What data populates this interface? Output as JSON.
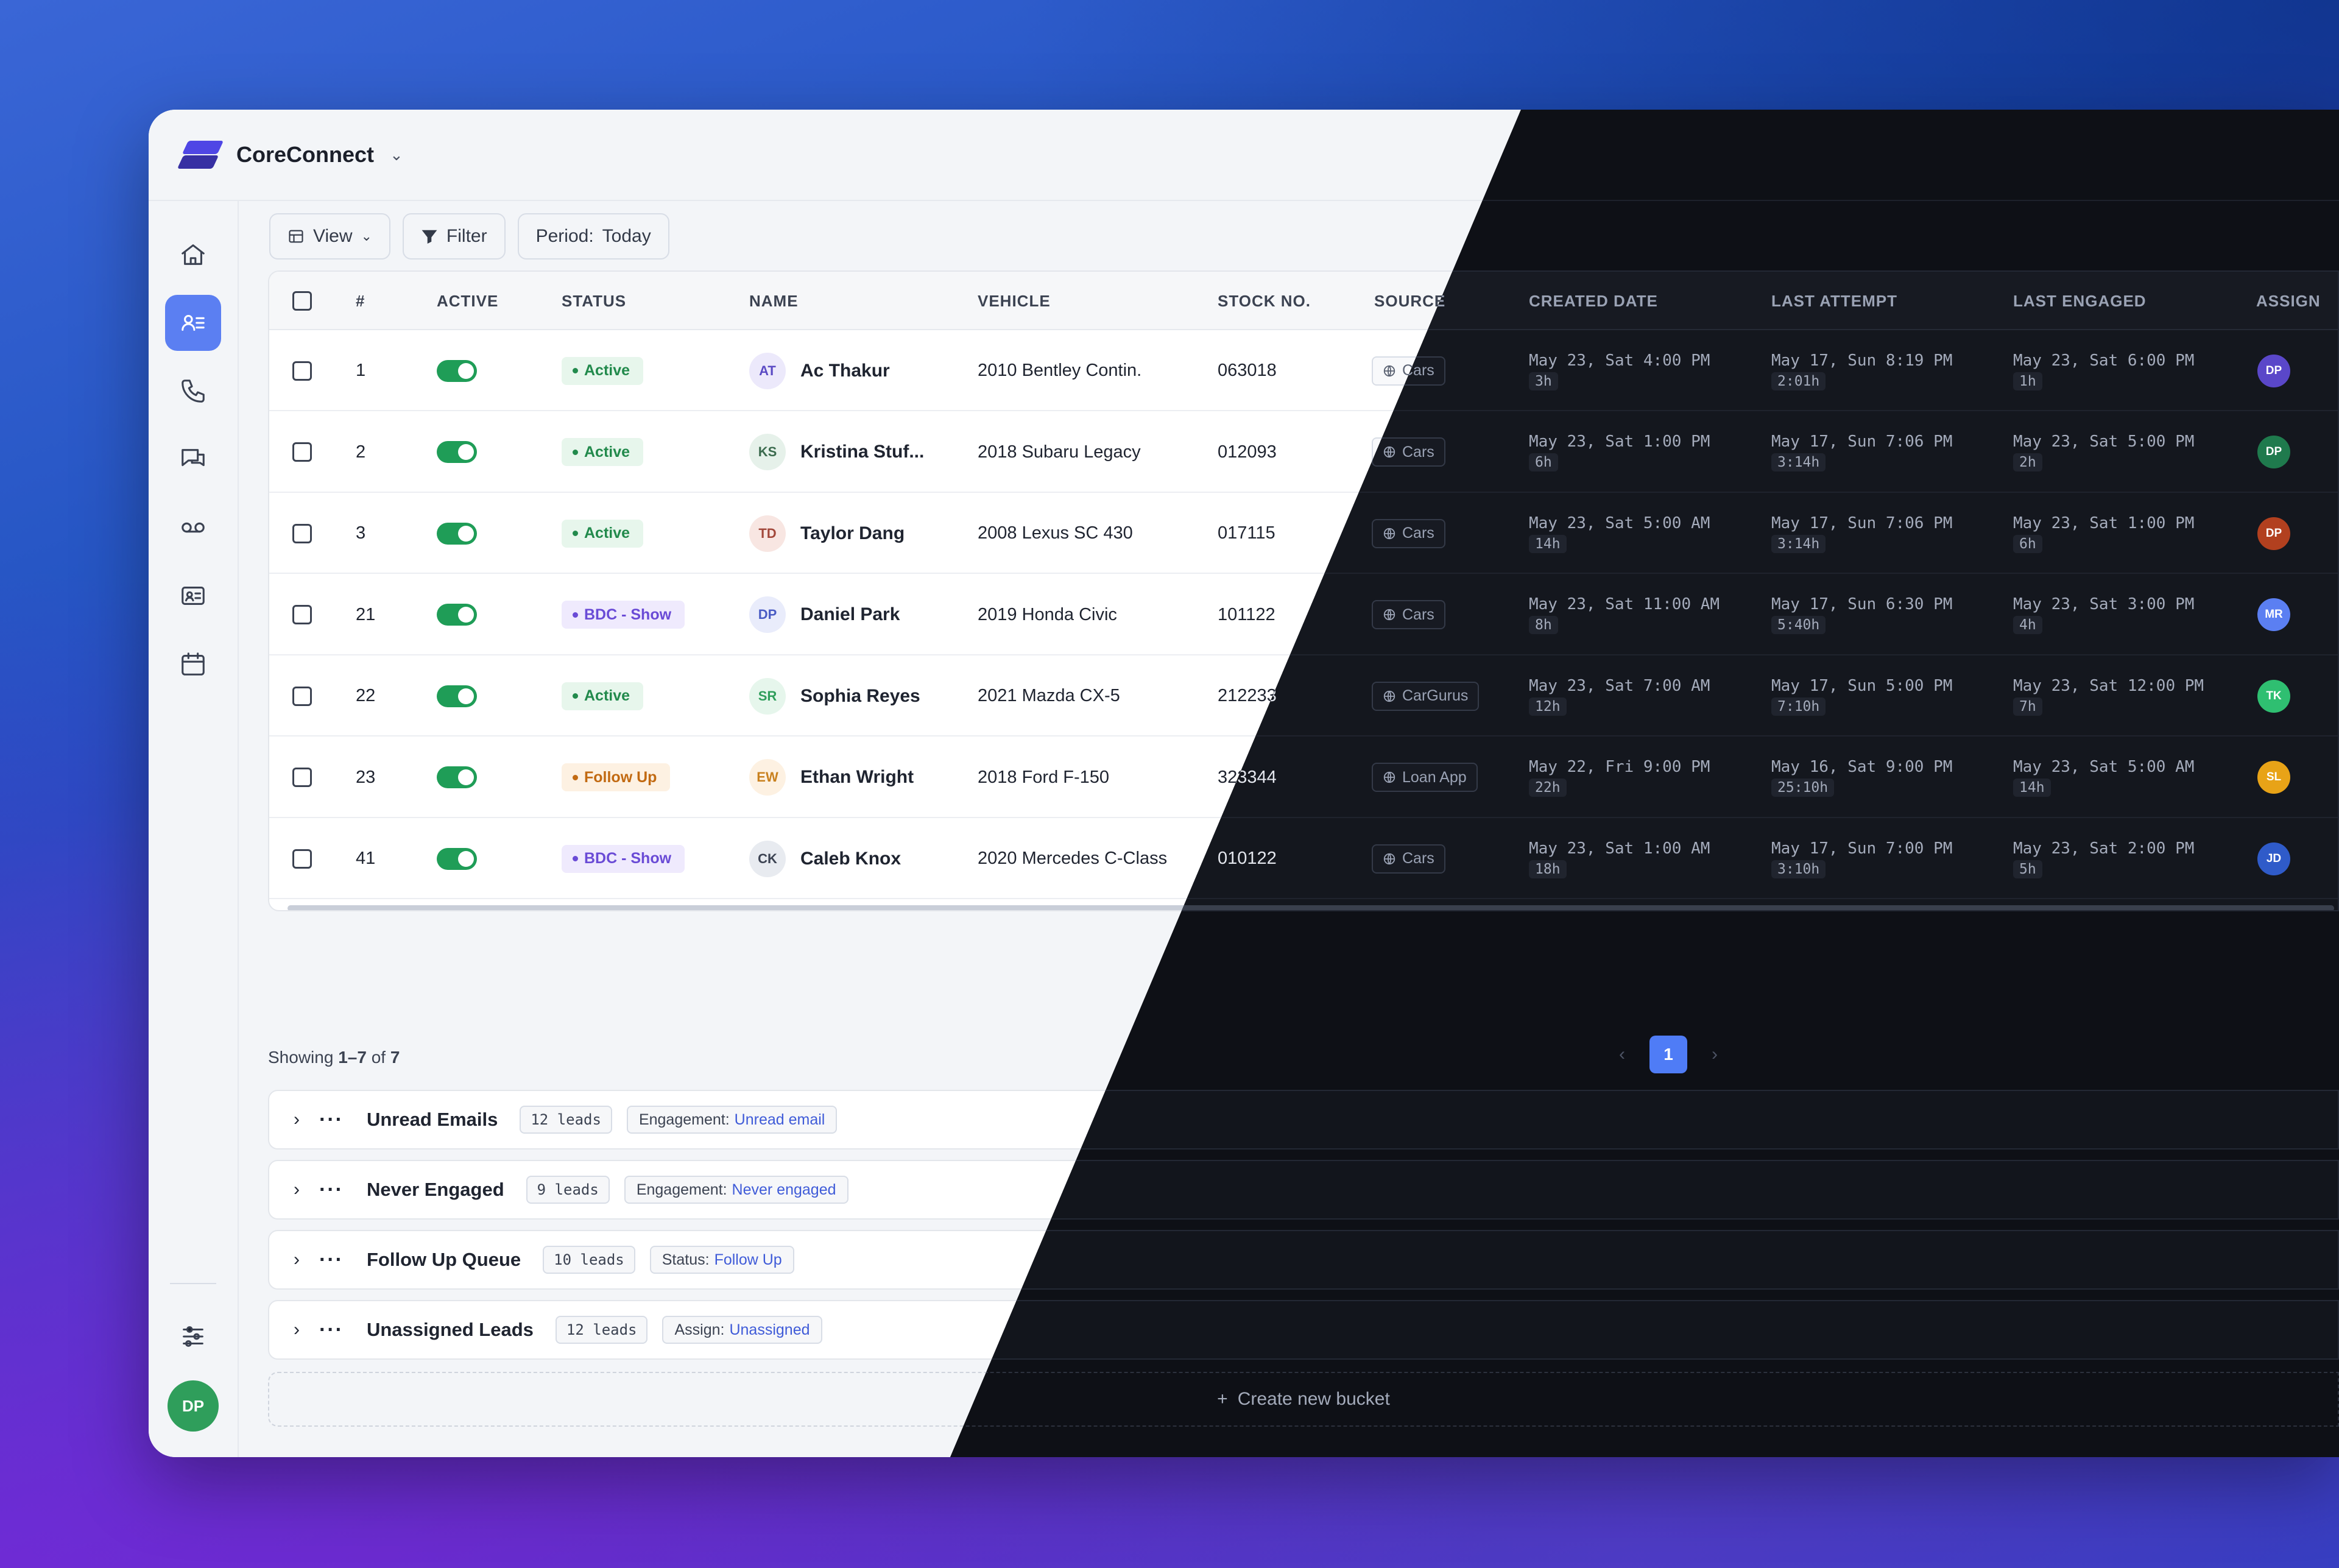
{
  "app": {
    "name": "CoreConnect"
  },
  "user": {
    "initials": "DP",
    "color": "#2f9e5b"
  },
  "sidebar": {
    "items": [
      {
        "key": "home",
        "icon": "home-icon"
      },
      {
        "key": "leads",
        "icon": "contacts-list-icon",
        "active": true
      },
      {
        "key": "calls",
        "icon": "phone-icon"
      },
      {
        "key": "messages",
        "icon": "chat-icon"
      },
      {
        "key": "voicemail",
        "icon": "voicemail-icon"
      },
      {
        "key": "contacts",
        "icon": "id-card-icon"
      },
      {
        "key": "calendar",
        "icon": "calendar-icon"
      }
    ],
    "settings_icon": "sliders-icon"
  },
  "toolbar": {
    "view_label": "View",
    "filter_label": "Filter",
    "period_label": "Period:",
    "period_value": "Today"
  },
  "table": {
    "headers": {
      "num": "#",
      "active": "ACTIVE",
      "status": "STATUS",
      "name": "NAME",
      "vehicle": "VEHICLE",
      "stock": "STOCK NO.",
      "source": "SOURCE",
      "created": "CREATED DATE",
      "last_attempt": "LAST ATTEMPT",
      "last_engaged": "LAST ENGAGED",
      "assign": "ASSIGN"
    },
    "rows": [
      {
        "num": "1",
        "status": "Active",
        "status_kind": "active",
        "initials": "AT",
        "ini_bg": "#ece9fb",
        "ini_fg": "#5b4bc4",
        "name": "Ac Thakur",
        "vehicle": "2010 Bentley Contin.",
        "stock": "063018",
        "source": "Cars",
        "created": "May 23, Sat 4:00 PM",
        "created_ago": "3h",
        "attempt": "May 17, Sun 8:19 PM",
        "attempt_ago": "2:01h",
        "engaged": "May 23, Sat 6:00 PM",
        "engaged_ago": "1h",
        "assign": "DP",
        "assign_color": "#5a47c9"
      },
      {
        "num": "2",
        "status": "Active",
        "status_kind": "active",
        "initials": "KS",
        "ini_bg": "#e6f1ea",
        "ini_fg": "#3b6b4e",
        "name": "Kristina Stuf...",
        "vehicle": "2018 Subaru Legacy",
        "stock": "012093",
        "source": "Cars",
        "created": "May 23, Sat 1:00 PM",
        "created_ago": "6h",
        "attempt": "May 17, Sun 7:06 PM",
        "attempt_ago": "3:14h",
        "engaged": "May 23, Sat 5:00 PM",
        "engaged_ago": "2h",
        "assign": "DP",
        "assign_color": "#1f7a4d"
      },
      {
        "num": "3",
        "status": "Active",
        "status_kind": "active",
        "initials": "TD",
        "ini_bg": "#f8e6e2",
        "ini_fg": "#a2473a",
        "name": "Taylor Dang",
        "vehicle": "2008 Lexus SC 430",
        "stock": "017115",
        "source": "Cars",
        "created": "May 23, Sat 5:00 AM",
        "created_ago": "14h",
        "attempt": "May 17, Sun 7:06 PM",
        "attempt_ago": "3:14h",
        "engaged": "May 23, Sat 1:00 PM",
        "engaged_ago": "6h",
        "assign": "DP",
        "assign_color": "#b2401f"
      },
      {
        "num": "21",
        "status": "BDC - Show",
        "status_kind": "bdc",
        "initials": "DP",
        "ini_bg": "#e9ecfb",
        "ini_fg": "#4a5cc4",
        "name": "Daniel Park",
        "vehicle": "2019 Honda Civic",
        "stock": "101122",
        "source": "Cars",
        "created": "May 23, Sat 11:00 AM",
        "created_ago": "8h",
        "attempt": "May 17, Sun 6:30 PM",
        "attempt_ago": "5:40h",
        "engaged": "May 23, Sat 3:00 PM",
        "engaged_ago": "4h",
        "assign": "MR",
        "assign_color": "#5b7ff2"
      },
      {
        "num": "22",
        "status": "Active",
        "status_kind": "active",
        "initials": "SR",
        "ini_bg": "#e6f6ec",
        "ini_fg": "#2f9e5b",
        "name": "Sophia Reyes",
        "vehicle": "2021 Mazda CX-5",
        "stock": "212233",
        "source": "CarGurus",
        "created": "May 23, Sat 7:00 AM",
        "created_ago": "12h",
        "attempt": "May 17, Sun 5:00 PM",
        "attempt_ago": "7:10h",
        "engaged": "May 23, Sat 12:00 PM",
        "engaged_ago": "7h",
        "assign": "TK",
        "assign_color": "#2fbf71"
      },
      {
        "num": "23",
        "status": "Follow Up",
        "status_kind": "follow",
        "initials": "EW",
        "ini_bg": "#fdf1e2",
        "ini_fg": "#c9811f",
        "name": "Ethan Wright",
        "vehicle": "2018 Ford F-150",
        "stock": "323344",
        "source": "Loan App",
        "created": "May 22, Fri 9:00 PM",
        "created_ago": "22h",
        "attempt": "May 16, Sat 9:00 PM",
        "attempt_ago": "25:10h",
        "engaged": "May 23, Sat 5:00 AM",
        "engaged_ago": "14h",
        "assign": "SL",
        "assign_color": "#e8a317"
      },
      {
        "num": "41",
        "status": "BDC - Show",
        "status_kind": "bdc",
        "initials": "CK",
        "ini_bg": "#e8ebf0",
        "ini_fg": "#3c4352",
        "name": "Caleb Knox",
        "vehicle": "2020 Mercedes C-Class",
        "stock": "010122",
        "source": "Cars",
        "created": "May 23, Sat 1:00 AM",
        "created_ago": "18h",
        "attempt": "May 17, Sun 7:00 PM",
        "attempt_ago": "3:10h",
        "engaged": "May 23, Sat 2:00 PM",
        "engaged_ago": "5h",
        "assign": "JD",
        "assign_color": "#2f5bc9"
      }
    ]
  },
  "pagination": {
    "showing_prefix": "Showing",
    "range": "1–7",
    "of_word": "of",
    "total": "7",
    "current_page": "1",
    "prev_glyph": "‹",
    "next_glyph": "›"
  },
  "buckets": [
    {
      "title": "Unread Emails",
      "count": "12 leads",
      "filter_key": "Engagement:",
      "filter_value": "Unread email"
    },
    {
      "title": "Never Engaged",
      "count": "9 leads",
      "filter_key": "Engagement:",
      "filter_value": "Never engaged"
    },
    {
      "title": "Follow Up Queue",
      "count": "10 leads",
      "filter_key": "Status:",
      "filter_value": "Follow Up"
    },
    {
      "title": "Unassigned Leads",
      "count": "12 leads",
      "filter_key": "Assign:",
      "filter_value": "Unassigned"
    }
  ],
  "create_bucket_label": "Create new bucket"
}
